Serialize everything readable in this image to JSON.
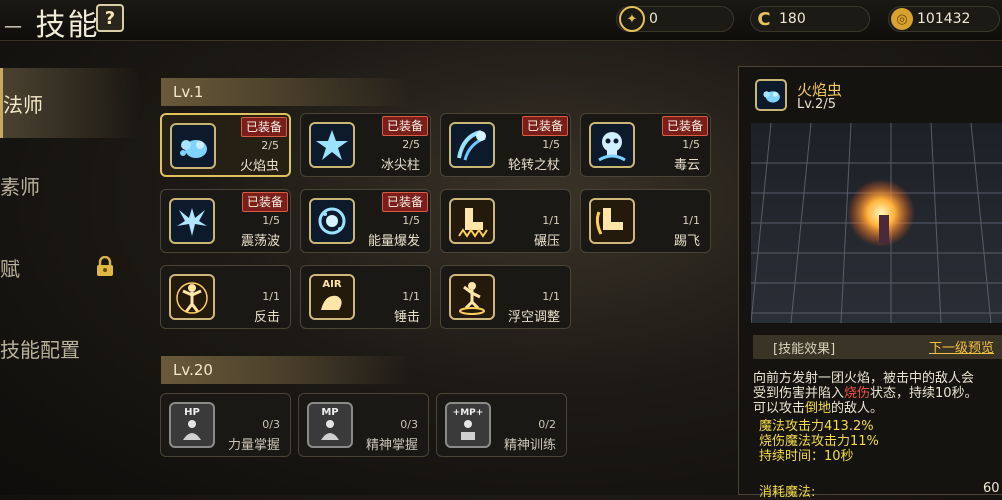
{
  "header": {
    "title": "技能",
    "help_label": "?"
  },
  "currencies": [
    {
      "icon": "compass-coin-icon",
      "value": "0"
    },
    {
      "icon": "c-coin-icon",
      "value": "180"
    },
    {
      "icon": "gold-coin-icon",
      "value": "101432"
    }
  ],
  "nav": [
    {
      "label": "法师",
      "active": true
    },
    {
      "label": "素师",
      "active": false
    },
    {
      "label": "赋",
      "active": false,
      "locked": true
    },
    {
      "label": "技能配置",
      "active": false
    }
  ],
  "sections": [
    {
      "label": "Lv.1"
    },
    {
      "label": "Lv.20"
    }
  ],
  "skills": [
    {
      "name": "火焰虫",
      "level": "2/5",
      "equipped": "已装备"
    },
    {
      "name": "冰尖柱",
      "level": "2/5",
      "equipped": "已装备"
    },
    {
      "name": "轮转之杖",
      "level": "1/5",
      "equipped": "已装备"
    },
    {
      "name": "毒云",
      "level": "1/5",
      "equipped": "已装备"
    },
    {
      "name": "震荡波",
      "level": "1/5",
      "equipped": "已装备"
    },
    {
      "name": "能量爆发",
      "level": "1/5",
      "equipped": "已装备"
    },
    {
      "name": "碾压",
      "level": "1/1"
    },
    {
      "name": "踢飞",
      "level": "1/1"
    },
    {
      "name": "反击",
      "level": "1/1"
    },
    {
      "name": "锤击",
      "level": "1/1",
      "icon_text": "AIR"
    },
    {
      "name": "浮空调整",
      "level": "1/1"
    },
    {
      "name": "力量掌握",
      "level": "0/3",
      "icon_text": "HP"
    },
    {
      "name": "精神掌握",
      "level": "0/3",
      "icon_text": "MP"
    },
    {
      "name": "精神训练",
      "level": "0/2",
      "icon_text": "+MP+"
    }
  ],
  "detail": {
    "name": "火焰虫",
    "level": "Lv.2/5",
    "effects_header": "[技能效果]",
    "next_level": "下一级预览",
    "desc_1": "向前方发射一团火焰，被击中的敌人会",
    "desc_2a": "受到伤害并陷入",
    "desc_2b": "烧伤",
    "desc_2c": "状态，持续10秒。",
    "desc_3a": "可以攻击",
    "desc_3b": "倒地",
    "desc_3c": "的敌人。",
    "stat_1": "魔法攻击力413.2%",
    "stat_2": "烧伤魔法攻击力11%",
    "stat_3": "持续时间：10秒",
    "cost_label": "消耗魔法:",
    "cost_value": "60"
  },
  "colors": {
    "accent": "#e0c25c",
    "equipped_badge": "#7a1e1a",
    "highlight_red": "#f0524a",
    "highlight_yellow": "#f2dc4a"
  }
}
